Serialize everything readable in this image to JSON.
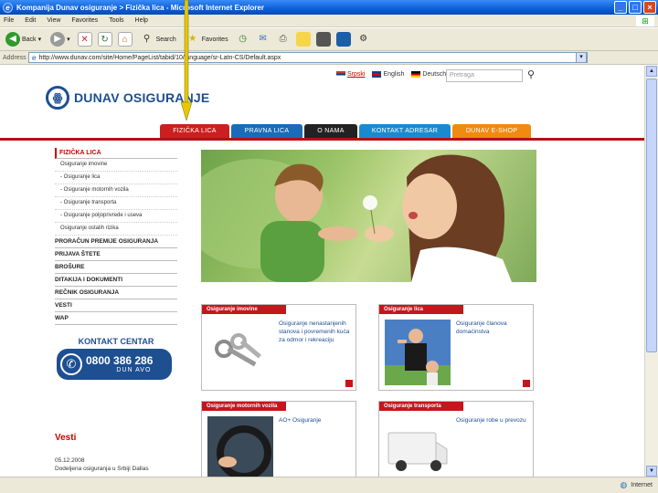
{
  "window": {
    "title": "Kompanija Dunav osiguranje > Fizička lica - Microsoft Internet Explorer"
  },
  "menu": [
    "File",
    "Edit",
    "View",
    "Favorites",
    "Tools",
    "Help"
  ],
  "toolbar": {
    "back_label": "Back",
    "search_label": "Search",
    "favorites_label": "Favorites"
  },
  "address": {
    "label": "Address",
    "url": "http://www.dunav.com/site/Home/PageList/tabid/10/language/sr-Latn-CS/Default.aspx"
  },
  "status": {
    "zone": "Internet"
  },
  "page": {
    "languages": [
      "Srpski",
      "English",
      "Deutsch"
    ],
    "search_placeholder": "Pretraga",
    "brand": "DUNAV OSIGURANJE",
    "tabs": [
      "FIZIČKA LICA",
      "PRAVNA LICA",
      "O NAMA",
      "KONTAKT ADRESAR",
      "DUNAV E-SHOP"
    ],
    "sidebar": {
      "head": "FIZIČKA LICA",
      "sub": [
        "Osiguranje imovine",
        "- Osiguranje lica",
        "- Osiguranje motornih vozila",
        "- Osiguranje transporta",
        "- Osiguranje poljoprivrede i useva",
        "Osiguranje ostalih rizika"
      ],
      "main": [
        "PRORAČUN PREMIJE OSIGURANJA",
        "PRIJAVA ŠTETE",
        "BROŠURE",
        "DITAKIJA I DOKUMENTI",
        "REČNIK OSIGURANJA",
        "VESTI",
        "WAP"
      ]
    },
    "contact": {
      "title": "KONTAKT CENTAR",
      "number": "0800 386 286",
      "hours": "DUN AVO"
    },
    "news": {
      "title": "Vesti",
      "date": "05.12.2008",
      "text": "Dodeljena osiguranja u Srbiji Dallas"
    },
    "cards": [
      {
        "head": "Osiguranje imovine",
        "text": "Osiguranje nenastanjenih stanova i povremenih kuća za odmor i rekreaciju"
      },
      {
        "head": "Osiguranje lica",
        "text": "Osiguranje članova domaćinstva"
      },
      {
        "head": "Osiguranje motornih vozila",
        "text": "AO+ Osiguranje"
      },
      {
        "head": "Osiguranje transporta",
        "text": "Osiguranje robe u prevozu"
      }
    ]
  }
}
